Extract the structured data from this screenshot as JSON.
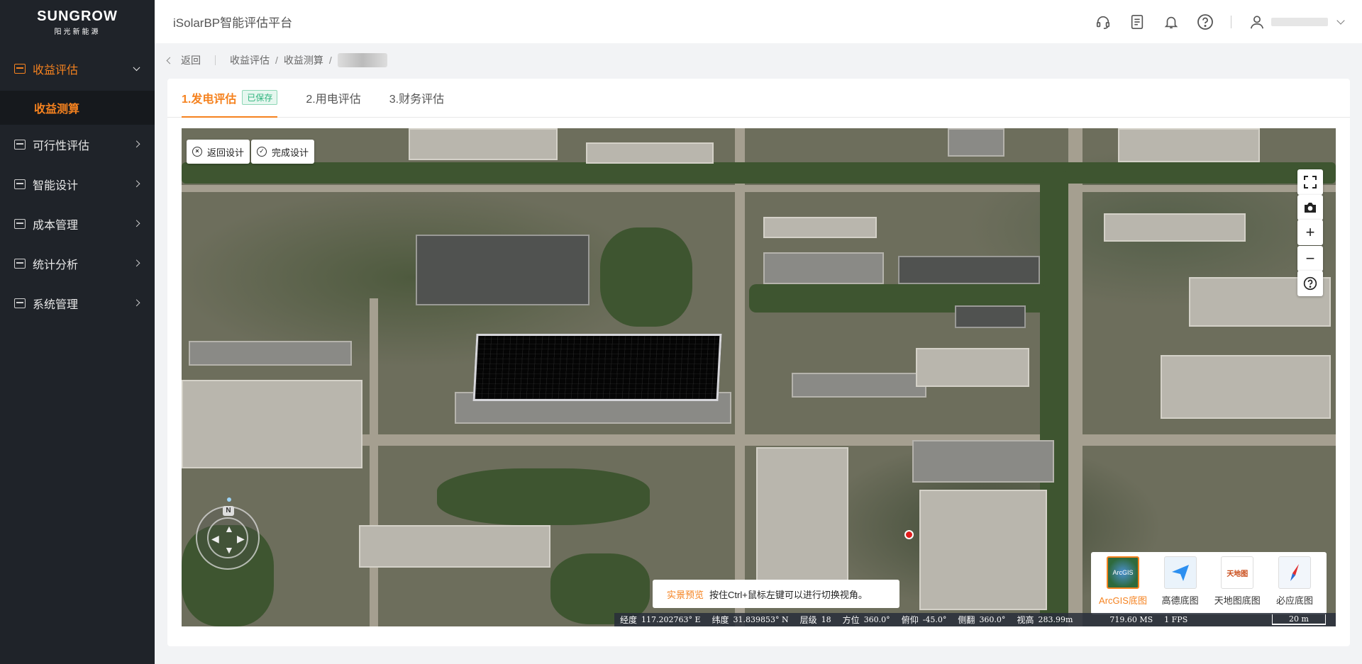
{
  "logo": {
    "brand": "SUNGROW",
    "sub": "阳光新能源"
  },
  "sidebar": {
    "items": [
      {
        "label": "收益评估",
        "icon": "revenue-icon",
        "open": true
      },
      {
        "label": "可行性评估",
        "icon": "feasibility-icon"
      },
      {
        "label": "智能设计",
        "icon": "design-icon"
      },
      {
        "label": "成本管理",
        "icon": "cost-icon"
      },
      {
        "label": "统计分析",
        "icon": "statistics-icon"
      },
      {
        "label": "系统管理",
        "icon": "system-icon"
      }
    ],
    "sub_active": "收益测算"
  },
  "header": {
    "title": "iSolarBP智能评估平台",
    "icons": [
      "headset-icon",
      "document-icon",
      "bell-icon",
      "help-icon",
      "user-icon"
    ]
  },
  "breadcrumb": {
    "back": "返回",
    "items": [
      "收益评估",
      "收益测算"
    ]
  },
  "tabs": [
    {
      "label": "1.发电评估",
      "badge": "已保存",
      "active": true
    },
    {
      "label": "2.用电评估"
    },
    {
      "label": "3.财务评估"
    }
  ],
  "map": {
    "buttons": {
      "back_design": "返回设计",
      "finish_design": "完成设计"
    },
    "controls": [
      "fullscreen-icon",
      "camera-icon",
      "zoom-in-icon",
      "zoom-out-icon",
      "help-icon"
    ],
    "compass_n": "N",
    "tip": {
      "highlight": "实景预览",
      "text": "按住Ctrl+鼠标左键可以进行切换视角。"
    },
    "basemaps": [
      {
        "label": "ArcGIS底图",
        "thumb": "ArcGIS",
        "active": true
      },
      {
        "label": "高德底图"
      },
      {
        "label": "天地图底图",
        "thumb": "天地图"
      },
      {
        "label": "必应底图"
      }
    ],
    "status": {
      "lon_label": "经度",
      "lon": "117.202763° E",
      "lat_label": "纬度",
      "lat": "31.839853° N",
      "level_label": "层级",
      "level": "18",
      "heading_label": "方位",
      "heading": "360.0°",
      "pitch_label": "俯仰",
      "pitch": "-45.0°",
      "roll_label": "侧翻",
      "roll": "360.0°",
      "height_label": "视高",
      "height": "283.99m",
      "ms": "719.60 MS",
      "fps": "1 FPS",
      "scale": "20 m"
    }
  }
}
